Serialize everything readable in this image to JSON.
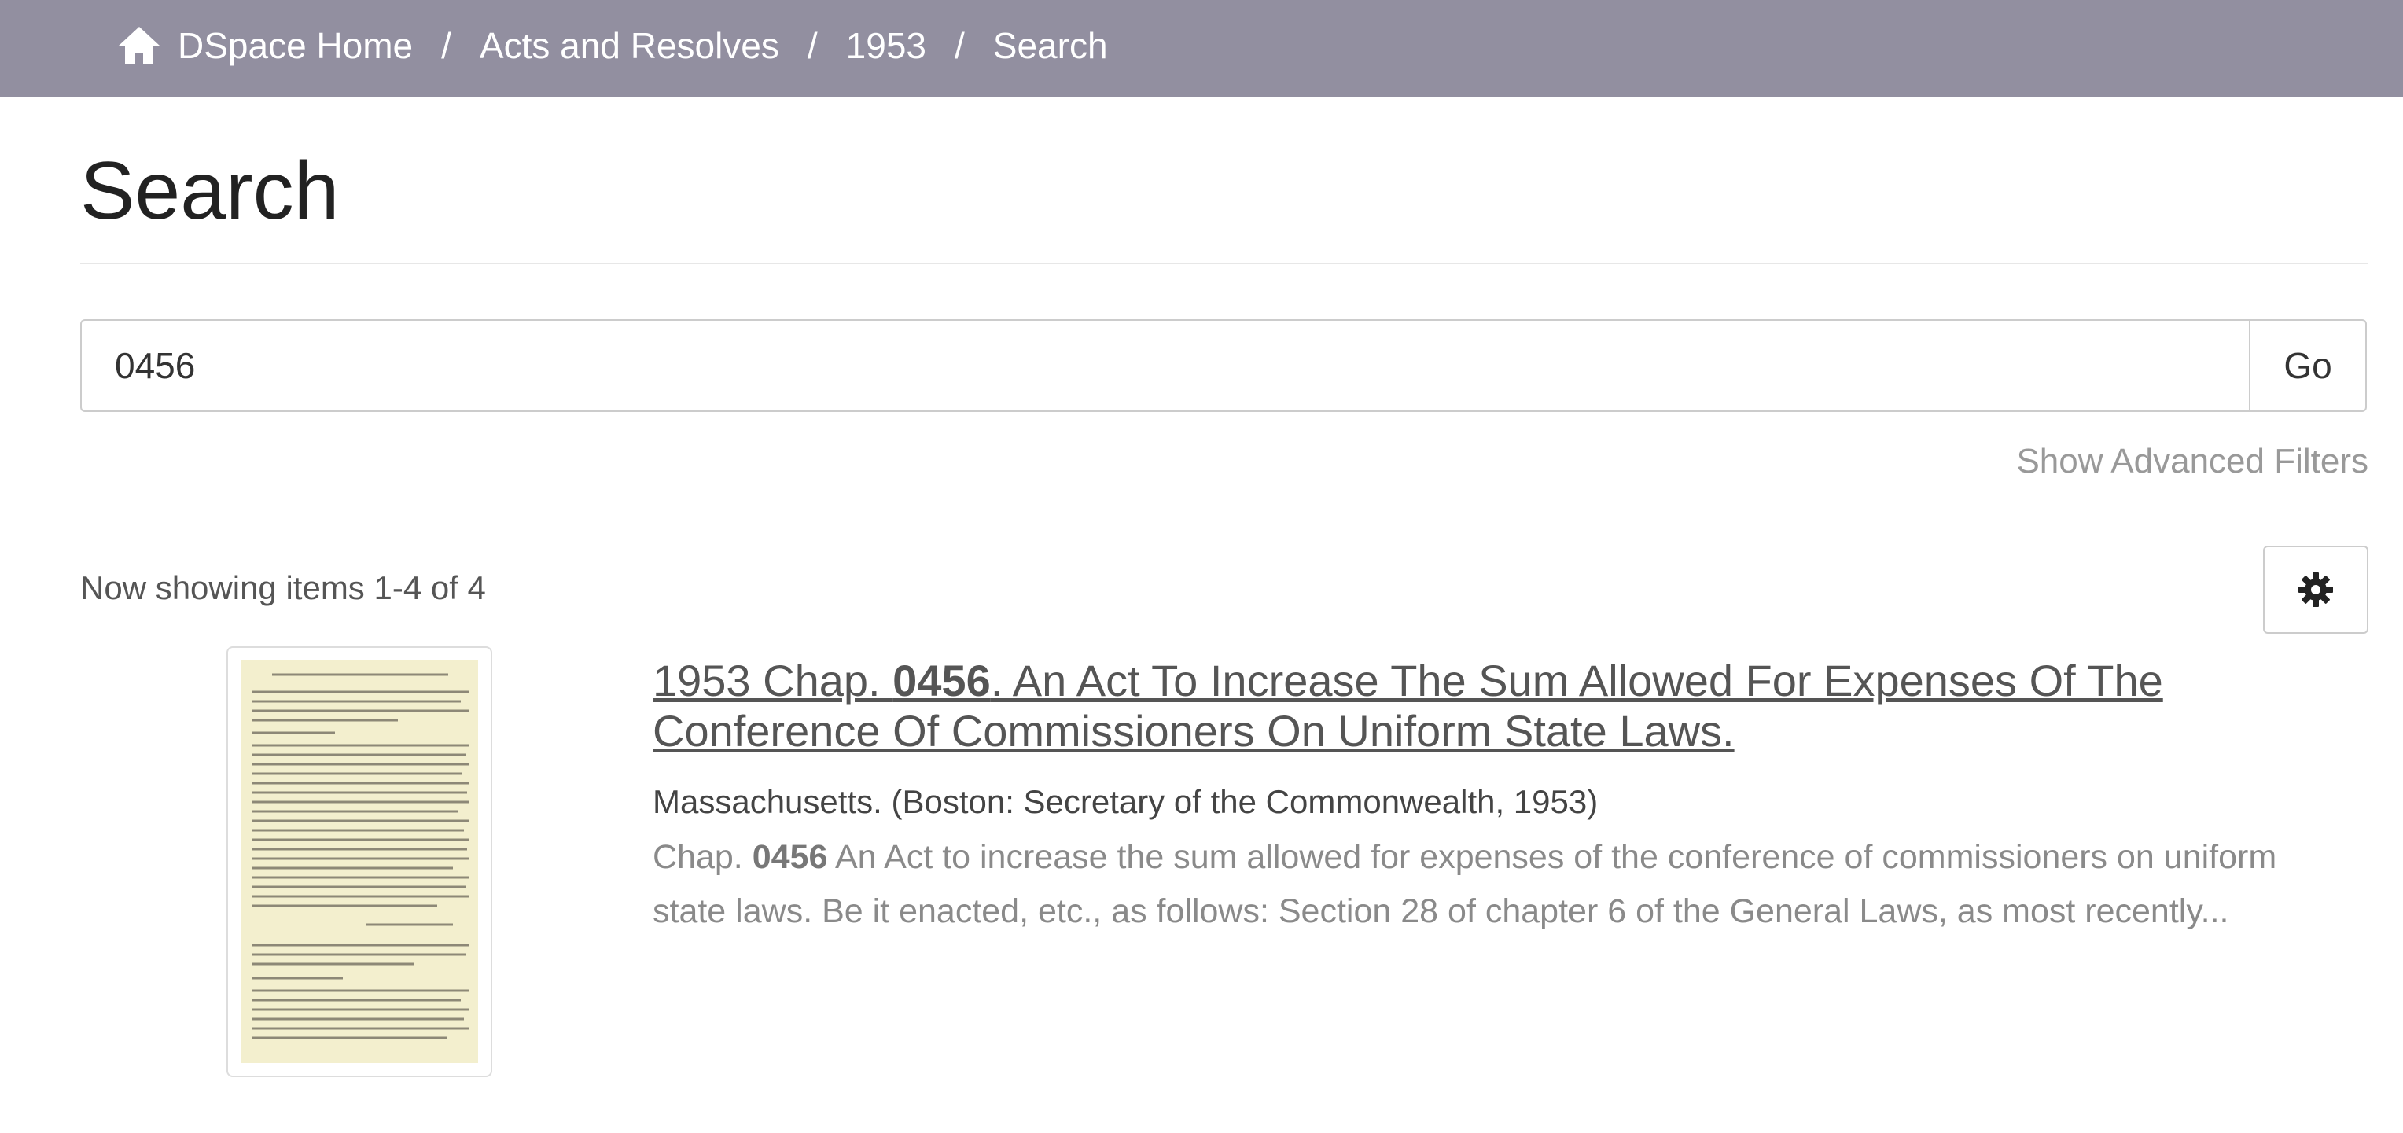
{
  "breadcrumb": {
    "home_icon": "home-icon",
    "home": "DSpace Home",
    "collection": "Acts and Resolves",
    "year": "1953",
    "current": "Search",
    "separator": "/"
  },
  "page": {
    "title": "Search"
  },
  "search": {
    "query": "0456",
    "go_label": "Go",
    "advanced_filters_label": "Show Advanced Filters"
  },
  "results": {
    "summary": "Now showing items 1-4 of 4",
    "settings_icon": "gear-icon",
    "items": [
      {
        "thumbnail": "document-thumbnail",
        "title_prefix": "1953 Chap. ",
        "title_highlight": "0456",
        "title_suffix": ". An Act To Increase The Sum Allowed For Expenses Of The Conference Of Commissioners On Uniform State Laws.",
        "publisher": "Massachusetts. (Boston: Secretary of the Commonwealth, 1953)",
        "abstract_prefix": "Chap. ",
        "abstract_highlight": "0456",
        "abstract_suffix": " An Act to increase the sum allowed for expenses of the conference of commissioners on uniform state laws. Be it enacted, etc., as follows: Section 28 of chapter 6 of the General Laws, as most recently..."
      }
    ]
  },
  "colors": {
    "breadcrumb_bg": "#928fa0",
    "thumbnail_paper": "#f3efce",
    "muted_text": "#8a8a8a"
  }
}
